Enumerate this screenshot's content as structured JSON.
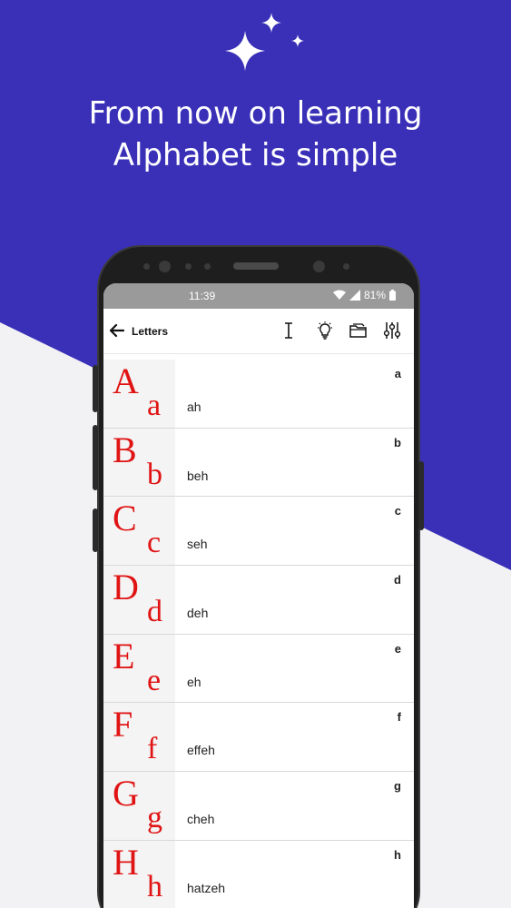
{
  "promo": {
    "headline_line1": "From now on learning",
    "headline_line2": "Alphabet is simple"
  },
  "colors": {
    "accent": "#3a30b8",
    "letter_red": "#e01414"
  },
  "statusbar": {
    "time": "11:39",
    "battery": "81%",
    "icons": [
      "wifi-icon",
      "signal-icon",
      "battery-icon"
    ]
  },
  "appbar": {
    "title": "Letters",
    "icons": [
      "text-cursor-icon",
      "lightbulb-icon",
      "folder-icon",
      "sliders-icon"
    ]
  },
  "letters": [
    {
      "upper": "A",
      "lower": "a",
      "small": "a",
      "pron": "ah"
    },
    {
      "upper": "B",
      "lower": "b",
      "small": "b",
      "pron": "beh"
    },
    {
      "upper": "C",
      "lower": "c",
      "small": "c",
      "pron": "seh"
    },
    {
      "upper": "D",
      "lower": "d",
      "small": "d",
      "pron": "deh"
    },
    {
      "upper": "E",
      "lower": "e",
      "small": "e",
      "pron": "eh"
    },
    {
      "upper": "F",
      "lower": "f",
      "small": "f",
      "pron": "effeh"
    },
    {
      "upper": "G",
      "lower": "g",
      "small": "g",
      "pron": "cheh"
    },
    {
      "upper": "H",
      "lower": "h",
      "small": "h",
      "pron": "hatzeh"
    }
  ]
}
